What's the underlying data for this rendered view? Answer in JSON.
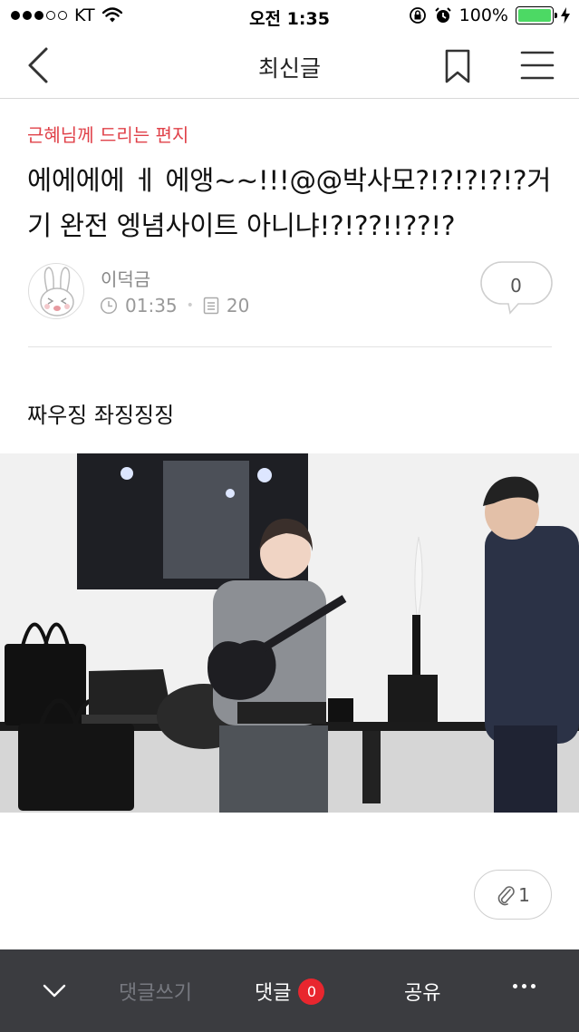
{
  "status_bar": {
    "carrier": "KT",
    "time": "오전 1:35",
    "battery": "100%",
    "signal_bars_filled": 3,
    "signal_bars_total": 5
  },
  "nav": {
    "title": "최신글",
    "back_icon": "chevron-left-icon",
    "bookmark_icon": "bookmark-icon",
    "menu_icon": "hamburger-menu-icon"
  },
  "post": {
    "category": "근혜님께 드리는 편지",
    "title": "에에에에 ㅔ 에앵~~!!!@@박사모?!?!?!?!?거기 완전 엥념사이트 아니냐!?!??!!??!?",
    "author": "이덕금",
    "time": "01:35",
    "views": "20",
    "comment_count": "0",
    "body": "짜우징 좌징징징",
    "attachment_count": "1"
  },
  "bottom_bar": {
    "write_comment": "댓글쓰기",
    "comments_label": "댓글",
    "comments_badge": "0",
    "share": "공유"
  },
  "colors": {
    "category": "#e0424a",
    "bottom_bar_bg": "#3b3c40",
    "badge": "#e8262e",
    "battery": "#4cd964"
  }
}
